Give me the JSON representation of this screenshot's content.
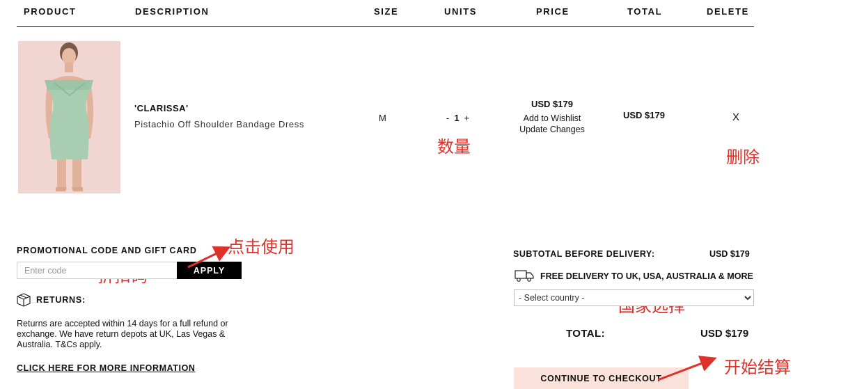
{
  "header": {
    "product": "PRODUCT",
    "description": "DESCRIPTION",
    "size": "SIZE",
    "units": "UNITS",
    "price": "PRICE",
    "total": "TOTAL",
    "delete": "DELETE"
  },
  "item": {
    "name": "'CLARISSA'",
    "description": "Pistachio Off Shoulder Bandage Dress",
    "size": "M",
    "qty_minus": "-",
    "qty": "1",
    "qty_plus": "+",
    "price": "USD $179",
    "add_wishlist": "Add to Wishlist",
    "update_changes": "Update Changes",
    "total": "USD $179",
    "delete": "X"
  },
  "promo": {
    "title": "PROMOTIONAL CODE AND GIFT CARD",
    "placeholder": "Enter code",
    "apply": "APPLY"
  },
  "returns": {
    "title": "RETURNS:",
    "text": "Returns are accepted within 14 days for a full refund or exchange. We have return depots at UK, Las Vegas & Australia. T&Cs apply.",
    "more_link": "CLICK HERE FOR MORE INFORMATION"
  },
  "summary": {
    "subtotal_label": "SUBTOTAL BEFORE DELIVERY:",
    "subtotal_value": "USD $179",
    "free_delivery": "FREE DELIVERY TO UK, USA, AUSTRALIA & MORE",
    "country_select": "- Select country -",
    "total_label": "TOTAL:",
    "total_value": "USD $179",
    "checkout": "CONTINUE TO CHECKOUT"
  },
  "annotations": {
    "quantity": "数量",
    "delete": "删除",
    "click_use": "点击使用",
    "discount_code": "折扣码",
    "country_select": "国家选择",
    "start_checkout": "开始结算",
    "color": "#e0302a"
  },
  "icons": {
    "returns": "box-icon",
    "delivery": "truck-icon"
  }
}
